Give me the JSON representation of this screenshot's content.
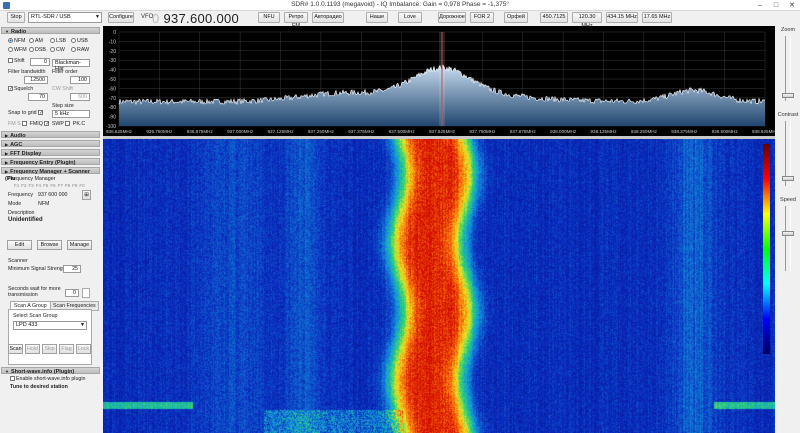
{
  "window": {
    "title": "SDR# 1.0.0.1193 (megavoid) - IQ Imbalance: Gain = 0,978 Phase = -1,375°"
  },
  "toolbar": {
    "stop_label": "Stop",
    "source": "RTL-SDR / USB",
    "configure_label": "Configure",
    "vfo_label": "VFO",
    "vfo_frequency": "937.600.000",
    "presets": [
      "NFU",
      "Ретро FM",
      "Авторадио",
      "Наше",
      "Love",
      "Дорожное",
      "FOR 2",
      "Орфей"
    ],
    "freqs": [
      "450.7125",
      "120.30 MHz",
      "434.15 MHz",
      "17.65 MHz"
    ]
  },
  "radio": {
    "header": "Radio",
    "modes_row1": [
      "NFM",
      "AM",
      "LSB",
      "USB"
    ],
    "modes_row2": [
      "WFM",
      "DSB",
      "CW",
      "RAW"
    ],
    "selected_mode": "NFM",
    "shift_label": "Shift",
    "shift_value": "0",
    "window": "Blackman-Har",
    "filter_bandwidth_label": "Filter bandwidth",
    "filter_bandwidth": "12500",
    "filter_order_label": "Filter order",
    "filter_order": "100",
    "squelch_label": "Squelch",
    "squelch_value": "70",
    "cw_shift_label": "CW Shift",
    "cw_shift": "600",
    "step_label": "Step size",
    "snap_label": "Snap to grid",
    "step_value": "5 kHz",
    "fm_stereo": "FM S",
    "fmiq": "FMIQ",
    "swap": "SWP",
    "pkt": "PK.C"
  },
  "sections": [
    "Audio",
    "AGC",
    "FFT Display",
    "Frequency Entry (Plugin)",
    "Frequency Manager + Scanner (Plu"
  ],
  "fm": {
    "title": "Frequency Manager",
    "tabs": [
      "F1",
      "F2",
      "F3",
      "F4",
      "F5",
      "F6",
      "F7",
      "F8",
      "F9",
      "F0"
    ],
    "frequency_label": "Frequency",
    "frequency": "937 600 000",
    "mode_label": "Mode",
    "mode": "NFM",
    "desc_label": "Description",
    "desc": "Unidentified",
    "edit": "Edit",
    "browse": "Browse",
    "manage": "Manage"
  },
  "scanner": {
    "title": "Scanner",
    "min_signal_label": "Minimum Signal Strength",
    "min_signal": "25",
    "wait_label": "Seconds wait for more transmission",
    "wait": "0",
    "tab1": "Scan A Group",
    "tab2": "Scan Frequencies",
    "select_group_label": "Select Scan Group",
    "group": "LPD 433",
    "buttons": [
      "Scan",
      "Hold",
      "Skip",
      "Flag",
      "Lock"
    ]
  },
  "shortwave": {
    "header": "Short-wave.info (Plugin)",
    "enable_label": "Enable short-wave.info plugin",
    "tune_label": "Tune to desired station"
  },
  "spectrum": {
    "db_labels": [
      "0",
      "-10",
      "-20",
      "-30",
      "-40",
      "-50",
      "-60",
      "-70",
      "-80",
      "-90",
      "-100"
    ],
    "freq_labels": [
      "936.625MHz",
      "936.750MHz",
      "936.875MHz",
      "937.000MHz",
      "937.125MHz",
      "937.250MHz",
      "937.375MHz",
      "937.500MHz",
      "937.625MHz",
      "937.750MHz",
      "937.875MHz",
      "938.000MHz",
      "938.125MHz",
      "938.250MHz",
      "938.375MHz",
      "938.500MHz",
      "938.625MHz"
    ],
    "colors": {
      "grid": "#3a3a3a",
      "trace": "#ffffff",
      "fill_top": "#c9dcef",
      "fill_bottom": "#20466f",
      "marker": "#c05050"
    }
  },
  "side": {
    "zoom": "Zoom",
    "contrast": "Contrast",
    "speed": "Speed"
  }
}
